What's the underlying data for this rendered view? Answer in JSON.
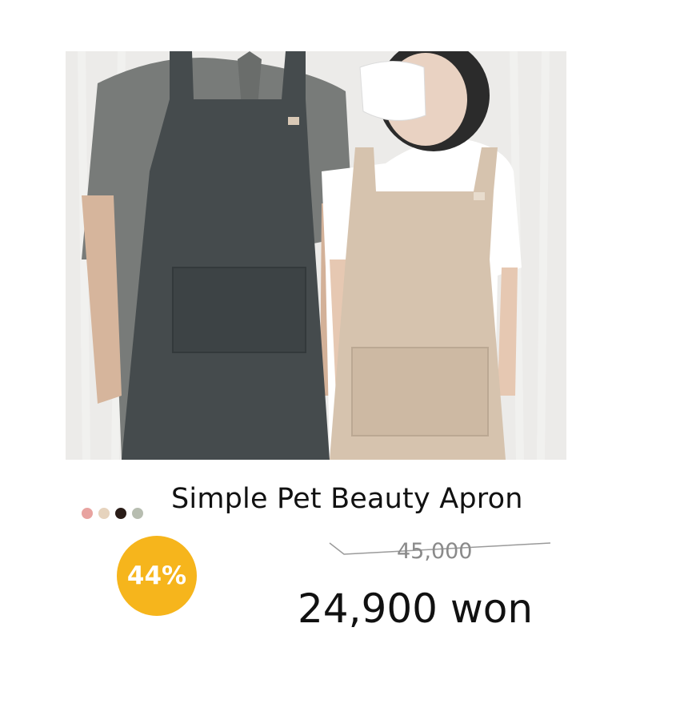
{
  "product": {
    "image_alt": "Two people wearing charcoal and beige aprons",
    "title": "Simple Pet Beauty Apron",
    "discount_badge": "44%",
    "original_price": "45,000",
    "sale_price": "24,900 won",
    "color_options": [
      {
        "name": "pink",
        "hex": "#e8a3a0"
      },
      {
        "name": "beige",
        "hex": "#e6d3bd"
      },
      {
        "name": "dark-brown",
        "hex": "#2a1d18"
      },
      {
        "name": "sage",
        "hex": "#b7bdb0"
      }
    ]
  },
  "colors": {
    "badge": "#f6b51c",
    "text_primary": "#111111",
    "text_muted": "#8a8a8a"
  }
}
